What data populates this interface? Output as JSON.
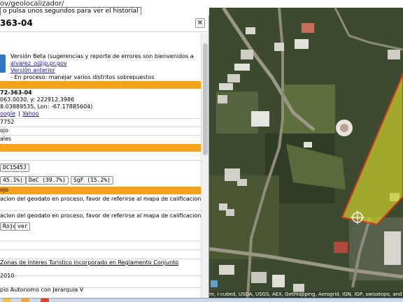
{
  "browser": {
    "url_tail": "ov/geolocalizador/",
    "tooltip": "o pulsa unos segundos para ver el historial"
  },
  "panel": {
    "title": "363-04",
    "close_label": "×",
    "beta_line1": "Versión Beta (sugerencias y reporte de errores son bienvenidos a",
    "email": "alvarez_o@jp.pr.gov",
    "previous_version": "Versión anterior",
    "in_process": "- En proceso: manejar varios distritos sobrepuestos",
    "cadastre_number": "72-363-04",
    "coordinates_xy": "063.0030, y: 222912.3986",
    "lat_lon": "8.03889535, Lon: -67.17885604)",
    "map_links": {
      "google": "oogle",
      "separator": "|",
      "yahoo": "Yahoo"
    },
    "line_area": "7752",
    "line_municipality": "ojo",
    "line_ales": "ales",
    "code_button": "DC1545J",
    "percent_buttons": [
      "45.1%)",
      "DeC (39.7%)",
      "SgF (15.2%)"
    ],
    "section_ojo": "ojo",
    "calif_line1a": "acion del geodato en proceso, favor de referirse al mapa de calificacion",
    "calif_line2a": "acion del geodato en proceso, favor de referirse al mapa de calificacion",
    "button_rojo": "Rojo",
    "button_ver": "ver",
    "zonas_link": "Zonas de Interes Turistico incorporado en Reglamento Conjunto",
    "year": "2010",
    "autonomo": "pio Autonomo con Jerarquia V"
  },
  "map": {
    "copyright": "re, i-cubed, USDA, USGS, AEX, Getmapping, Aerogrid, IGN, IGP, swisstopo, and the GIS User Commu"
  },
  "colors": {
    "accent_orange": "#f6a31b",
    "parcel_fill": "#c9cf2b",
    "parcel_outline": "#d23a1c",
    "link_blue": "#1a1aa6"
  }
}
